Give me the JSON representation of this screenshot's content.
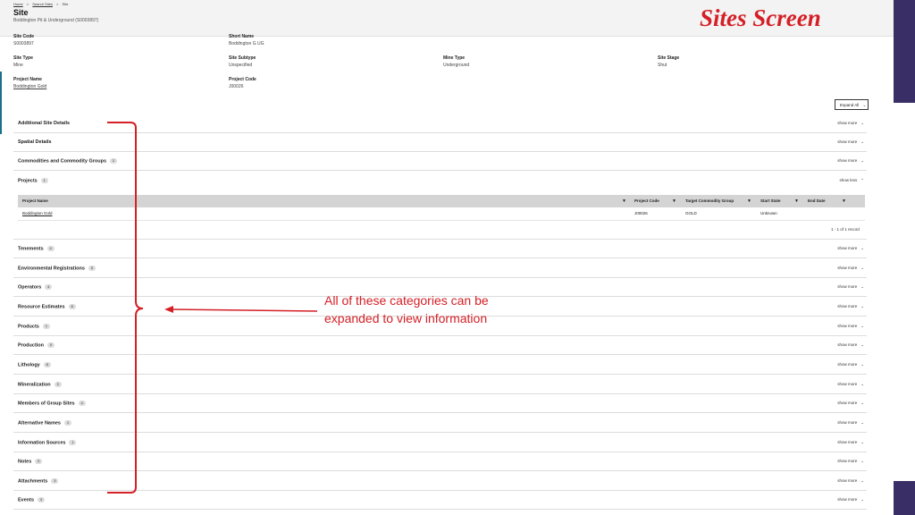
{
  "breadcrumb": [
    "Home",
    ">",
    "Search Sites",
    ">",
    "Site"
  ],
  "page_title": "Site",
  "page_subtitle": "Boddington Pit & Underground   (S0003897)",
  "screen_title": "Sites Screen",
  "fields": [
    {
      "label": "Site Code",
      "value": "S0003897"
    },
    {
      "label": "Short Name",
      "value": "Boddington G UG"
    },
    {
      "label": "Site Type",
      "value": "Mine"
    },
    {
      "label": "Site Subtype",
      "value": "Unspecified"
    },
    {
      "label": "Mine Type",
      "value": "Underground"
    },
    {
      "label": "Site Stage",
      "value": "Shut"
    },
    {
      "label": "Project Name",
      "value": "Boddington Gold"
    },
    {
      "label": "Project Code",
      "value": "J00026"
    }
  ],
  "expand_all_label": "Expand All",
  "show_more_label": "show more",
  "show_less_label": "show less",
  "sections": [
    {
      "name": "Additional Site Details",
      "count": ""
    },
    {
      "name": "Spatial Details",
      "count": ""
    },
    {
      "name": "Commodities and Commodity Groups",
      "count": "2"
    },
    {
      "name": "Projects",
      "count": "1"
    },
    {
      "name": "Tenements",
      "count": "4"
    },
    {
      "name": "Environmental Registrations",
      "count": "5"
    },
    {
      "name": "Operators",
      "count": "4"
    },
    {
      "name": "Resource Estimates",
      "count": "8"
    },
    {
      "name": "Products",
      "count": "1"
    },
    {
      "name": "Production",
      "count": "0"
    },
    {
      "name": "Lithology",
      "count": "8"
    },
    {
      "name": "Mineralization",
      "count": "3"
    },
    {
      "name": "Members of Group Sites",
      "count": "4"
    },
    {
      "name": "Alternative Names",
      "count": "1"
    },
    {
      "name": "Information Sources",
      "count": "1"
    },
    {
      "name": "Notes",
      "count": "0"
    },
    {
      "name": "Attachments",
      "count": "3"
    },
    {
      "name": "Events",
      "count": "4"
    }
  ],
  "projects_table": {
    "headers": [
      "Project Name",
      "Project Code",
      "Target Commodity Group",
      "Start State",
      "End Date"
    ],
    "rows": [
      [
        "Boddington Gold",
        "J00026",
        "GOLD",
        "Unknown",
        ""
      ]
    ],
    "record_info": "1 - 1 of 1 record"
  },
  "annotation": {
    "line1": "All of these categories can be",
    "line2": "expanded to view information"
  },
  "colors": {
    "accent_red": "#d42027",
    "side_purple": "#3a2e66"
  }
}
